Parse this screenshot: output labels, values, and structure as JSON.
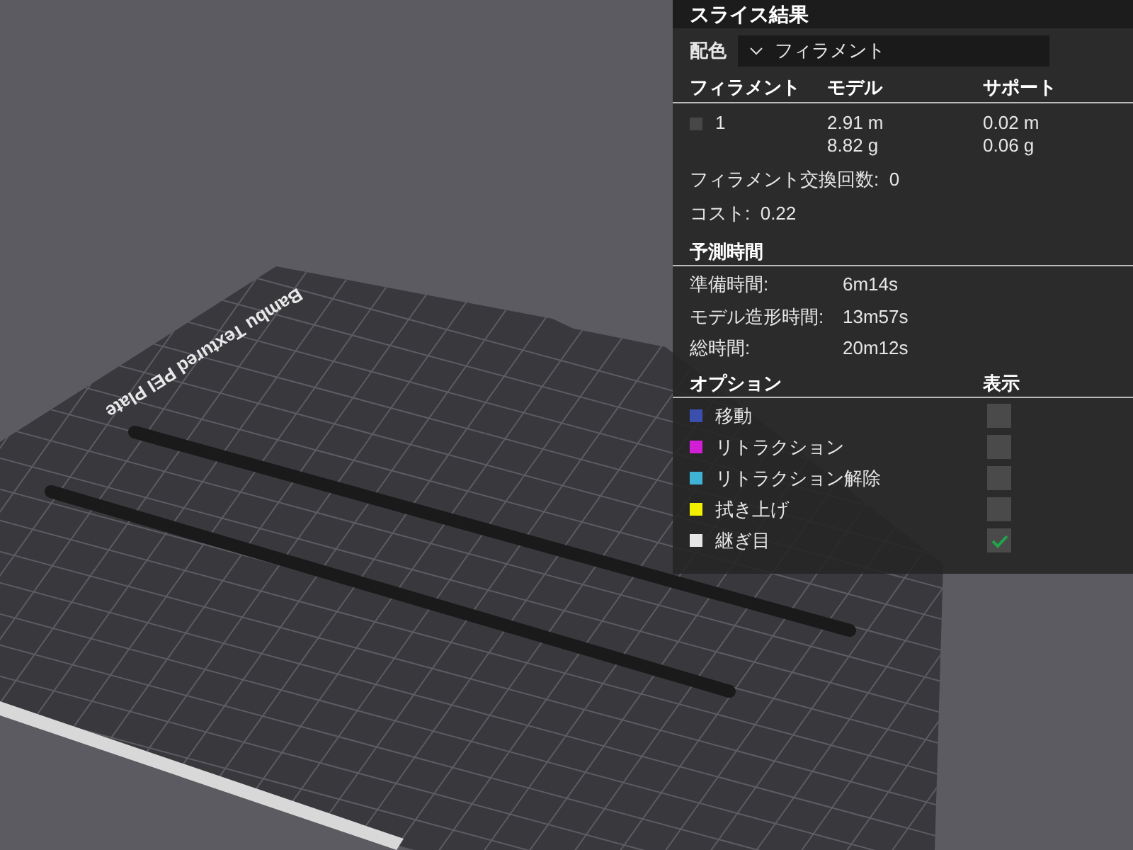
{
  "viewport": {
    "plate_label": "Bambu Textured PEI Plate"
  },
  "panel": {
    "title": "スライス結果",
    "color_scheme": {
      "label": "配色",
      "value": "フィラメント"
    },
    "filament_table": {
      "columns": [
        "フィラメント",
        "モデル",
        "サポート"
      ],
      "rows": [
        {
          "filament": "1",
          "color": "#474747",
          "model": [
            "2.91 m",
            "8.82 g"
          ],
          "support": [
            "0.02 m",
            "0.06 g"
          ]
        }
      ]
    },
    "summary": [
      "フィラメント交換回数:  0",
      "コスト:  0.22"
    ],
    "time": {
      "title": "予測時間",
      "rows": [
        {
          "label": "準備時間:",
          "value": "6m14s"
        },
        {
          "label": "モデル造形時間:",
          "value": "13m57s"
        },
        {
          "label": "総時間:",
          "value": "20m12s"
        }
      ]
    },
    "options": {
      "columns": [
        "オプション",
        "表示"
      ],
      "items": [
        {
          "label": "移動",
          "color": "#3b4fae",
          "checked": false
        },
        {
          "label": "リトラクション",
          "color": "#d11fd6",
          "checked": false
        },
        {
          "label": "リトラクション解除",
          "color": "#3fb3d6",
          "checked": false
        },
        {
          "label": "拭き上げ",
          "color": "#f2f000",
          "checked": false
        },
        {
          "label": "継ぎ目",
          "color": "#e6e6e6",
          "checked": true
        }
      ]
    }
  }
}
